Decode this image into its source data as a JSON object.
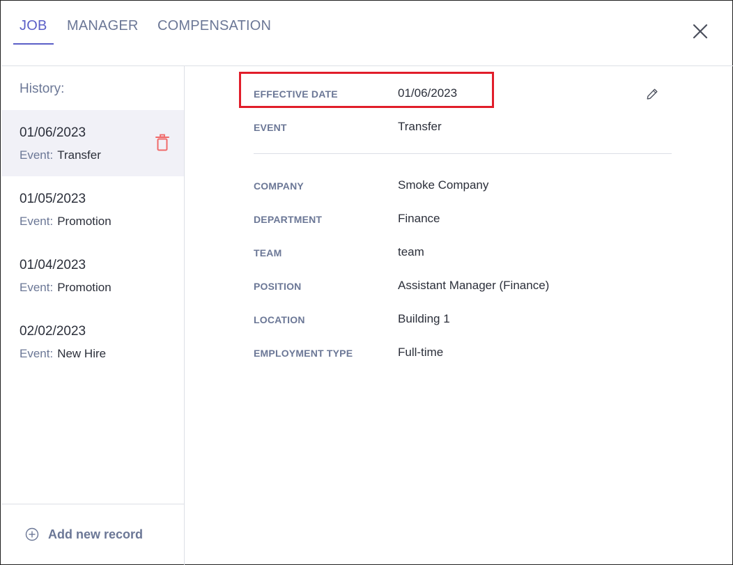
{
  "tabs": [
    {
      "label": "JOB",
      "active": true
    },
    {
      "label": "MANAGER",
      "active": false
    },
    {
      "label": "COMPENSATION",
      "active": false
    }
  ],
  "history": {
    "title": "History:",
    "event_label": "Event:",
    "records": [
      {
        "date": "01/06/2023",
        "event": "Transfer",
        "selected": true
      },
      {
        "date": "01/05/2023",
        "event": "Promotion",
        "selected": false
      },
      {
        "date": "01/04/2023",
        "event": "Promotion",
        "selected": false
      },
      {
        "date": "02/02/2023",
        "event": "New Hire",
        "selected": false
      }
    ],
    "add_label": "Add new record"
  },
  "details": {
    "effective_date": {
      "label": "EFFECTIVE DATE",
      "value": "01/06/2023"
    },
    "event": {
      "label": "EVENT",
      "value": "Transfer"
    },
    "company": {
      "label": "COMPANY",
      "value": "Smoke Company"
    },
    "department": {
      "label": "DEPARTMENT",
      "value": "Finance"
    },
    "team": {
      "label": "TEAM",
      "value": "team"
    },
    "position": {
      "label": "POSITION",
      "value": "Assistant Manager (Finance)"
    },
    "location": {
      "label": "LOCATION",
      "value": "Building 1"
    },
    "employment_type": {
      "label": "EMPLOYMENT TYPE",
      "value": "Full-time"
    }
  },
  "icons": {
    "close": "close-icon",
    "trash": "trash-icon",
    "edit": "pencil-icon",
    "add": "plus-circle-icon"
  },
  "colors": {
    "accent": "#5b5fc7",
    "muted": "#6b7796",
    "text": "#2b2f3a",
    "danger": "#f06a6a",
    "highlight": "#e11d2a",
    "selected_bg": "#f1f1f7"
  }
}
